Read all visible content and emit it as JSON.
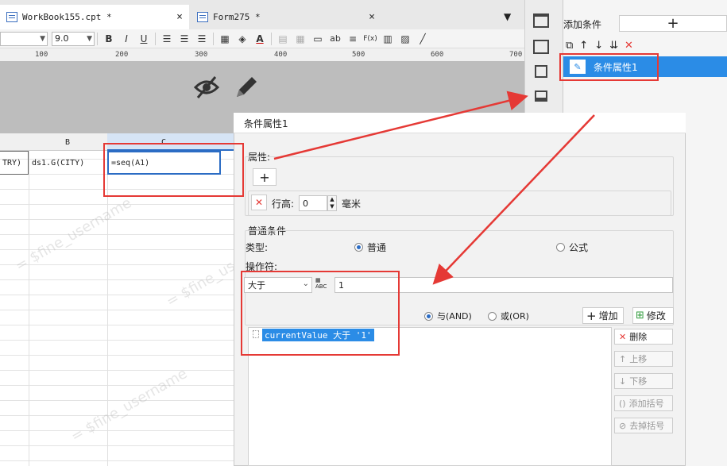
{
  "tabs": [
    {
      "label": "WorkBook155.cpt *",
      "close": "×"
    },
    {
      "label": "Form275 *",
      "close": "×"
    }
  ],
  "toolbar": {
    "font_size": "9.0",
    "bold": "B",
    "italic": "I",
    "underline": "U",
    "text_sample": "ab",
    "formula": "F(x)"
  },
  "ruler": [
    "100",
    "200",
    "300",
    "400",
    "500",
    "600",
    "700"
  ],
  "columns": [
    "B",
    "C"
  ],
  "cells": {
    "a1_partial": "TRY)",
    "b1": "ds1.G(CITY)",
    "c1": "=seq(A1)"
  },
  "watermark": "= $fine_username",
  "right_panel": {
    "add_condition_label": "添加条件",
    "add_button": "+",
    "item": "条件属性1"
  },
  "dialog": {
    "title": "条件属性1",
    "attr_label": "属性:",
    "add_attr_icon": "+",
    "row_height_label": "行高:",
    "row_height_value": "0",
    "unit": "毫米",
    "normal_cond_label": "普通条件",
    "type_label": "类型:",
    "type_normal": "普通",
    "type_formula": "公式",
    "operator_label": "操作符:",
    "operator_value": "大于",
    "operand_value": "1",
    "and_label": "与(AND)",
    "or_label": "或(OR)",
    "add_btn": "增加",
    "modify_btn": "修改",
    "condition_item": "currentValue 大于 '1'",
    "buttons": [
      "删除",
      "上移",
      "下移",
      "添加括号",
      "去掉括号"
    ]
  }
}
